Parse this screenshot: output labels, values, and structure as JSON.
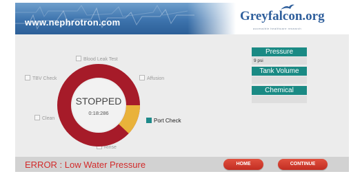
{
  "header": {
    "site_url": "www.nephrotron.com",
    "logo": "Greyfalcon.org",
    "tagline": "accessible healthcare research"
  },
  "checks": {
    "blood_leak_test": "Blood Leak Test",
    "tbv_check": "TBV Check",
    "affusion": "Affusion",
    "clean": "Clean",
    "port_check": "Port Check",
    "rinse": "Rinse"
  },
  "gauge": {
    "status": "STOPPED",
    "timer": "0:18:286",
    "progress_fraction": 0.12,
    "colors": {
      "track": "#a61b29",
      "progress": "#e9b23a",
      "center": "#f2f2f2"
    }
  },
  "panel": {
    "pressure_label": "Pressure",
    "pressure_value": "9 psi",
    "tank_label": "Tank Volume",
    "tank_value": "",
    "chemical_label": "Chemical",
    "chemical_value": ""
  },
  "footer": {
    "error": "ERROR : Low Water Pressure",
    "home": "HOME",
    "continue": "CONTINUE"
  },
  "colors": {
    "accent": "#1a8a84",
    "error": "#d22a2a",
    "button": "#c93428"
  }
}
